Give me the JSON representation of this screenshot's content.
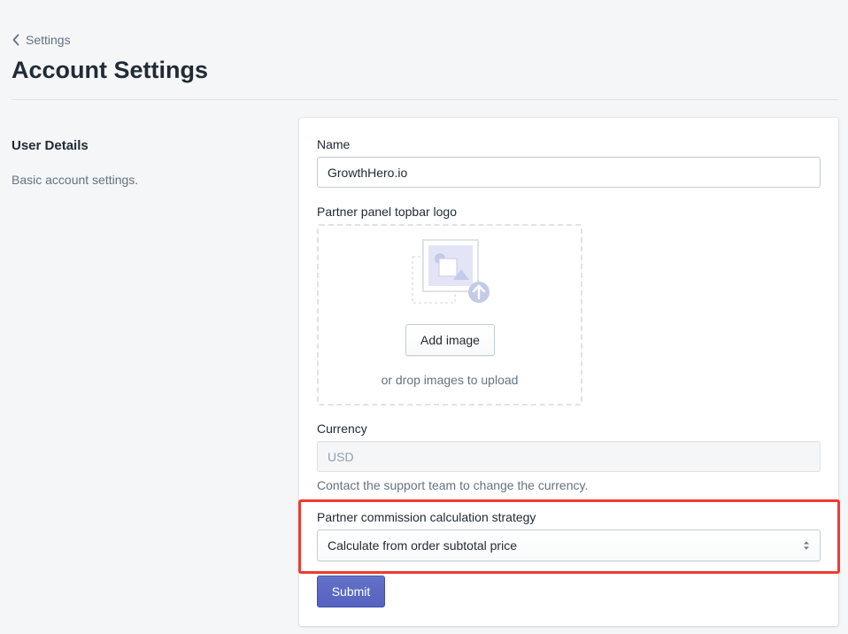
{
  "breadcrumb": {
    "label": "Settings"
  },
  "page": {
    "title": "Account Settings"
  },
  "section": {
    "title": "User Details",
    "description": "Basic account settings."
  },
  "form": {
    "name": {
      "label": "Name",
      "value": "GrowthHero.io"
    },
    "logo": {
      "label": "Partner panel topbar logo",
      "button_label": "Add image",
      "drop_hint": "or drop images to upload"
    },
    "currency": {
      "label": "Currency",
      "value": "USD",
      "help": "Contact the support team to change the currency."
    },
    "strategy": {
      "label": "Partner commission calculation strategy",
      "selected": "Calculate from order subtotal price"
    },
    "submit_label": "Submit"
  },
  "colors": {
    "primary": "#5c6ac4",
    "highlight": "#ef3b2f",
    "background": "#f4f6f8"
  },
  "icons": {
    "back": "chevron-left-icon",
    "upload": "image-upload-illustration",
    "select": "select-arrows-icon"
  }
}
